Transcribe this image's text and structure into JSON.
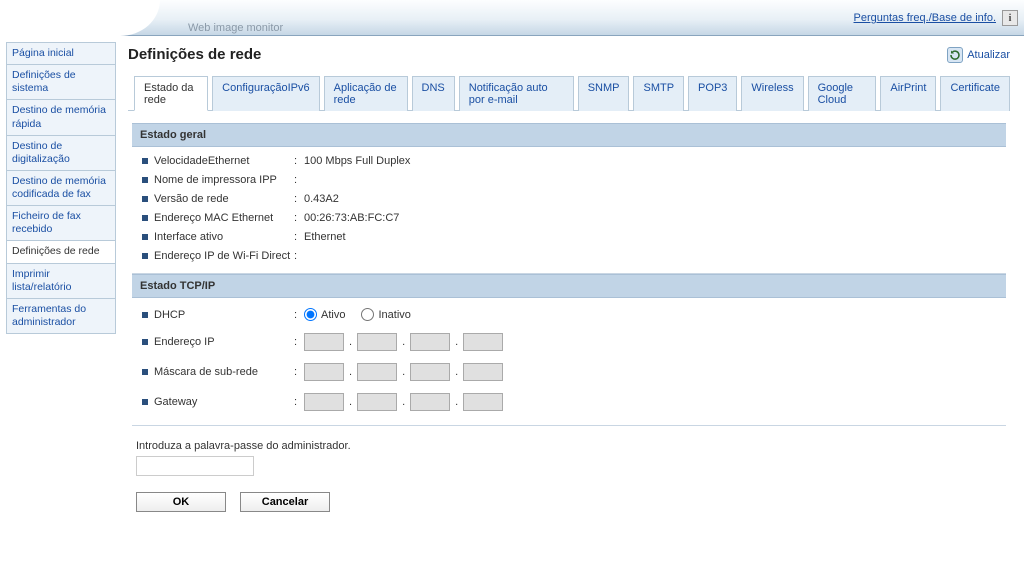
{
  "header": {
    "faq_link": "Perguntas freq./Base de info.",
    "monitor_label": "Web image monitor"
  },
  "sidebar": {
    "items": [
      "Página inicial",
      "Definições de sistema",
      "Destino de memória rápida",
      "Destino de digitalização",
      "Destino de memória codificada de fax",
      "Ficheiro de fax recebido",
      "Definições de rede",
      "Imprimir lista/relatório",
      "Ferramentas do administrador"
    ],
    "active_index": 6
  },
  "page": {
    "title": "Definições de rede",
    "refresh_label": "Atualizar"
  },
  "tabs": {
    "items": [
      "Estado da rede",
      "ConfiguraçãoIPv6",
      "Aplicação de rede",
      "DNS",
      "Notificação auto por e-mail",
      "SNMP",
      "SMTP",
      "POP3",
      "Wireless",
      "Google Cloud",
      "AirPrint",
      "Certificate"
    ],
    "active_index": 0
  },
  "sections": {
    "general": {
      "title": "Estado geral",
      "rows": [
        {
          "label": "VelocidadeEthernet",
          "value": "100 Mbps Full Duplex"
        },
        {
          "label": "Nome de impressora IPP",
          "value": ""
        },
        {
          "label": "Versão de rede",
          "value": "0.43A2"
        },
        {
          "label": "Endereço MAC Ethernet",
          "value": "00:26:73:AB:FC:C7"
        },
        {
          "label": "Interface ativo",
          "value": "Ethernet"
        },
        {
          "label": "Endereço IP de Wi-Fi Direct",
          "value": ""
        }
      ]
    },
    "tcpip": {
      "title": "Estado TCP/IP",
      "dhcp": {
        "label": "DHCP",
        "option_active": "Ativo",
        "option_inactive": "Inativo",
        "value": "active"
      },
      "ip": {
        "label": "Endereço IP",
        "octets": [
          "",
          "",
          "",
          ""
        ]
      },
      "mask": {
        "label": "Máscara de sub-rede",
        "octets": [
          "",
          "",
          "",
          ""
        ]
      },
      "gateway": {
        "label": "Gateway",
        "octets": [
          "",
          "",
          "",
          ""
        ]
      }
    }
  },
  "admin": {
    "prompt": "Introduza a palavra-passe do administrador.",
    "value": ""
  },
  "buttons": {
    "ok": "OK",
    "cancel": "Cancelar"
  }
}
